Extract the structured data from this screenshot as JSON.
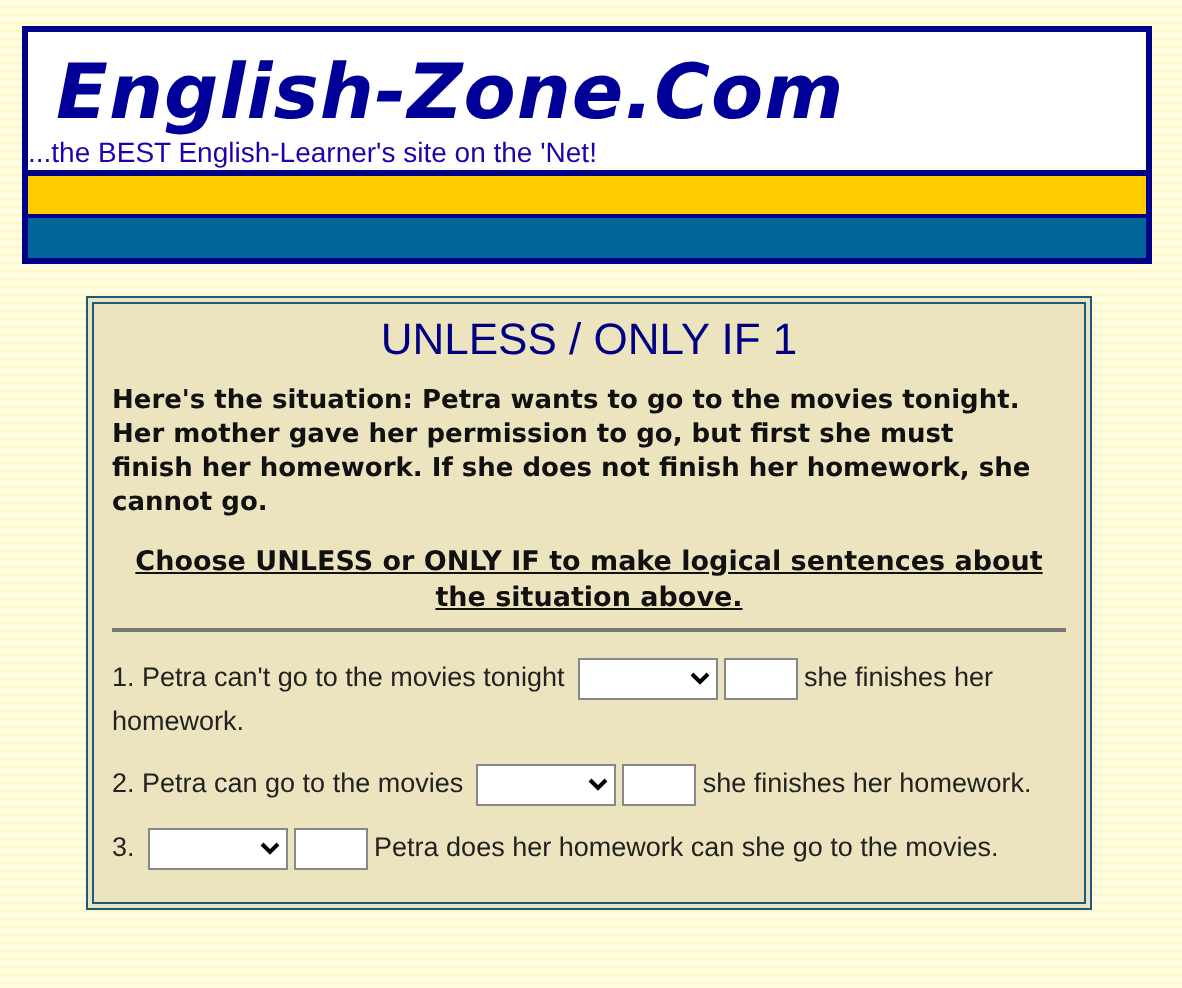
{
  "header": {
    "logo": "English-Zone.Com",
    "tagline": "...the BEST English-Learner's site on the 'Net!"
  },
  "exercise": {
    "title": "UNLESS / ONLY IF 1",
    "situation": "Here's the situation: Petra wants to go to the movies tonight. Her mother gave her permission to go, but first she must finish her homework. If she does not finish her homework, she cannot go.",
    "instruction": "Choose UNLESS or ONLY IF to make logical sentences about the situation above.",
    "questions": [
      {
        "parts": [
          {
            "kind": "text",
            "text": "1. Petra can't go to the movies tonight"
          },
          {
            "kind": "select"
          },
          {
            "kind": "blank"
          },
          {
            "kind": "text",
            "text": "she finishes her"
          },
          {
            "kind": "text",
            "text": "homework."
          }
        ]
      },
      {
        "parts": [
          {
            "kind": "text",
            "text": "2. Petra can go to the movies"
          },
          {
            "kind": "select"
          },
          {
            "kind": "blank"
          },
          {
            "kind": "text",
            "text": "she finishes her homework."
          }
        ]
      },
      {
        "parts": [
          {
            "kind": "text",
            "text": "3."
          },
          {
            "kind": "select"
          },
          {
            "kind": "blank"
          },
          {
            "kind": "text",
            "text": "Petra does her homework can she go to the movies."
          }
        ]
      }
    ]
  }
}
